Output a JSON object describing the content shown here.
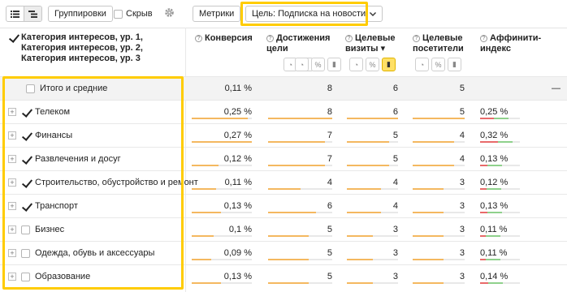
{
  "toolbar": {
    "list_view_icon": "list-icon",
    "tree_view_icon": "tree-icon",
    "grouping_label": "Группировки",
    "hidden_label": "Скрыв",
    "settings_icon": "gear-icon",
    "metrics_label": "Метрики",
    "goal_label": "Цель: Подписка на новости"
  },
  "header": {
    "dimension_label": "Категория интересов, ур. 1, Категория интересов, ур. 2, Категория интересов, ур. 3",
    "columns": [
      {
        "label": "Конверсия"
      },
      {
        "label": "Достижения цели"
      },
      {
        "label": "Целевые визиты",
        "sort": "▾"
      },
      {
        "label": "Целевые посетители"
      },
      {
        "label": "Аффинити-индекс"
      }
    ]
  },
  "colors": {
    "highlight": "#ffcc00",
    "bar_orange": "#f4b860",
    "bar_red": "#e86a6a",
    "bar_green": "#8fd18c"
  },
  "rows": [
    {
      "label": "Итого и средние",
      "checked": false,
      "expandable": false,
      "conversion": "0,11 %",
      "goals": "8",
      "visits": "6",
      "visitors": "5",
      "affinity": "—"
    },
    {
      "label": "Телеком",
      "checked": true,
      "expandable": true,
      "conversion": "0,25 %",
      "goals": "8",
      "visits": "6",
      "visitors": "5",
      "affinity": "0,25 %",
      "bars": [
        0.93,
        1.0,
        1.0,
        1.0,
        0.35
      ]
    },
    {
      "label": "Финансы",
      "checked": true,
      "expandable": true,
      "conversion": "0,27 %",
      "goals": "7",
      "visits": "5",
      "visitors": "4",
      "affinity": "0,32 %",
      "bars": [
        1.0,
        0.88,
        0.83,
        0.8,
        0.45
      ]
    },
    {
      "label": "Развлечения и досуг",
      "checked": true,
      "expandable": true,
      "conversion": "0,12 %",
      "goals": "7",
      "visits": "5",
      "visitors": "4",
      "affinity": "0,13 %",
      "bars": [
        0.45,
        0.88,
        0.83,
        0.8,
        0.18
      ]
    },
    {
      "label": "Строительство, обустройство и ремонт",
      "checked": true,
      "expandable": true,
      "conversion": "0,11 %",
      "goals": "4",
      "visits": "4",
      "visitors": "3",
      "affinity": "0,12 %",
      "bars": [
        0.4,
        0.5,
        0.67,
        0.6,
        0.17
      ]
    },
    {
      "label": "Транспорт",
      "checked": true,
      "expandable": true,
      "conversion": "0,13 %",
      "goals": "6",
      "visits": "4",
      "visitors": "3",
      "affinity": "0,13 %",
      "bars": [
        0.48,
        0.75,
        0.67,
        0.6,
        0.18
      ]
    },
    {
      "label": "Бизнес",
      "checked": false,
      "expandable": true,
      "conversion": "0,1 %",
      "goals": "5",
      "visits": "3",
      "visitors": "3",
      "affinity": "0,11 %",
      "bars": [
        0.37,
        0.63,
        0.5,
        0.6,
        0.15
      ]
    },
    {
      "label": "Одежда, обувь и аксессуары",
      "checked": false,
      "expandable": true,
      "conversion": "0,09 %",
      "goals": "5",
      "visits": "3",
      "visitors": "3",
      "affinity": "0,11 %",
      "bars": [
        0.33,
        0.63,
        0.5,
        0.6,
        0.15
      ]
    },
    {
      "label": "Образование",
      "checked": false,
      "expandable": true,
      "conversion": "0,13 %",
      "goals": "5",
      "visits": "3",
      "visitors": "3",
      "affinity": "0,14 %",
      "bars": [
        0.48,
        0.63,
        0.5,
        0.6,
        0.2
      ]
    }
  ]
}
